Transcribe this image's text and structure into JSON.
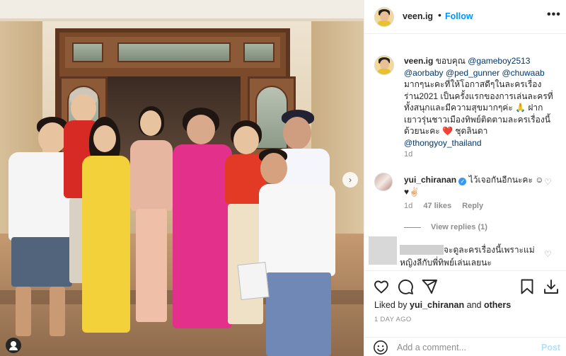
{
  "post": {
    "username": "veen.ig",
    "follow_label": "Follow",
    "header_separator": "•",
    "more_label": "•••"
  },
  "caption": {
    "username": "veen.ig",
    "text_1": " ขอบคุณ ",
    "mention_1": "@gameboy2513",
    "mention_2": "@aorbaby",
    "mention_3": "@ped_gunner",
    "mention_4": "@chuwaab",
    "text_2": " มากๆนะคะที่ให้โอกาสดีๆในละครเรื่อง ร่าน2021 เป็นครั้งแรกของการเล่นละครที่ทั้งสนุกและมีความสุขมากๆค่ะ 🙏 ฝากเยาวรุ่นชาวเมืองทิพย์ติดตามละครเรื่องนี้ด้วยนะคะ ",
    "heart": "❤️",
    "text_3": " ชุดลินดา ",
    "mention_5": "@thongyoy_thailand",
    "time": "1d"
  },
  "comment_1": {
    "username": "yui_chiranan",
    "verified_mark": "✓",
    "text": "ไว้เจอกันอีกนะคะ ☺♥✌🏻",
    "time": "1d",
    "likes": "47 likes",
    "reply_label": "Reply",
    "view_replies": "View replies (1)",
    "like_icon": "♡"
  },
  "comment_2": {
    "text_1": "จะดูละครเรื่องนี้เพราะแม่",
    "text_2": "หญิงลีกับพี่ทิพย์เล่นเลยนะ",
    "like_icon": "♡"
  },
  "actions": {
    "liked_prefix": "Liked by ",
    "liked_user": "yui_chiranan",
    "liked_mid": " and ",
    "liked_others": "others",
    "time_ago": "1 DAY AGO"
  },
  "add_comment": {
    "placeholder": "Add a comment...",
    "post_label": "Post"
  },
  "photo": {
    "carousel_next_icon": "›",
    "icons": [
      "chevron-right-icon",
      "user-tag-icon"
    ]
  },
  "colors": {
    "follow": "#0095f6",
    "link": "#00376b",
    "heart": "#e0245e",
    "post_disabled": "#b2dffc",
    "muted": "#8e8e8e"
  }
}
